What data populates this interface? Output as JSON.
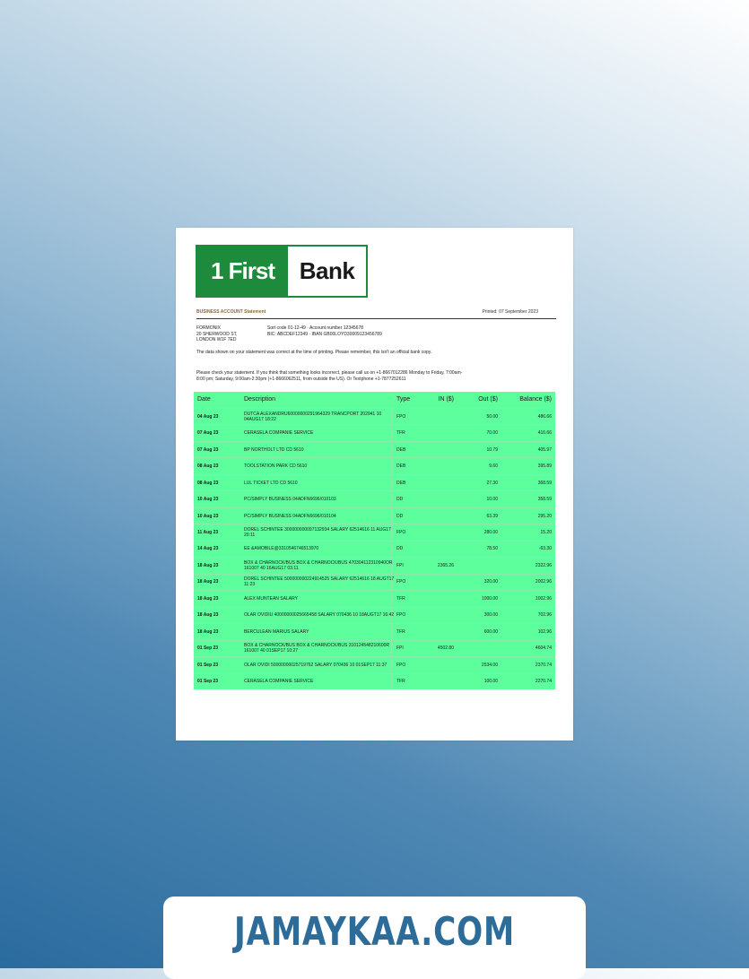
{
  "statement": {
    "logo": {
      "left": "1 First",
      "right": "Bank"
    },
    "header": {
      "title": "BUSINESS ACCOUNT Statement",
      "printed": "Printed: 07 September 2023"
    },
    "address": [
      "FORMONIX",
      "20 SHERWOOD ST,",
      "LONDON W1F 7ED"
    ],
    "codes": [
      "Sort code 01-12-49 · Account number 12345678",
      "BIC: ABCDEF12349 · IBAN GB00LOYD30009123456789"
    ],
    "note1": "The data shown on your statement was correct at the time of printing. Please remember, this isn't an official bank copy.",
    "note2": "Please check your statement. If you think that something looks incorrect, please call us on +1-8667012286 Monday to Friday, 7:00am-8:00 pm; Saturday, 9:00am-2:30pm (+1-8666062511, from outside the US). Or Textphone +1-7877252611",
    "columns": {
      "date": "Date",
      "desc": "Description",
      "type": "Type",
      "in": "IN ($)",
      "out": "Out ($)",
      "balance": "Balance ($)"
    },
    "rows": [
      {
        "date": "04 Aug 23",
        "desc": "DUTCA ALEXANDRU6000000029196432​9 TRANCPORT 202941 10 04AUG17 18:22",
        "type": "FPO",
        "in": "",
        "out": "50.00",
        "bal": "486.66"
      },
      {
        "date": "07 Aug 23",
        "desc": "CERASELA COMPANIE SERVICE",
        "type": "TFR",
        "in": "",
        "out": "70.00",
        "bal": "416.66"
      },
      {
        "date": "07 Aug 23",
        "desc": "BP NORTHOLT LTD CD 5610",
        "type": "DEB",
        "in": "",
        "out": "10.79",
        "bal": "405.97"
      },
      {
        "date": "08 Aug 23",
        "desc": "TOOLSTATION PARK CD 5610",
        "type": "DEB",
        "in": "",
        "out": "9.60",
        "bal": "395.89"
      },
      {
        "date": "08 Aug 23",
        "desc": "LUL TICKET LTD CD 5610",
        "type": "DEB",
        "in": "",
        "out": "27.30",
        "bal": "368.59"
      },
      {
        "date": "10 Aug 23",
        "desc": "PC/SIMPLY BUSINESS 04ADFN6696/010103",
        "type": "DD",
        "in": "",
        "out": "10.00",
        "bal": "358.59"
      },
      {
        "date": "10 Aug 23",
        "desc": "PC/SIMPLY BUSINESS 04ADFN6696/010104",
        "type": "DD",
        "in": "",
        "out": "63.39",
        "bal": "295.20"
      },
      {
        "date": "11 Aug 23",
        "desc": "DOREL SCHINTEE 300000000097132934 SALARY 62514616 11 AUG17 20:11",
        "type": "FPO",
        "in": "",
        "out": "280.00",
        "bal": "15.20"
      },
      {
        "date": "14 Aug 23",
        "desc": "EE &AMOBILE@3310546746513970",
        "type": "DD",
        "in": "",
        "out": "78.50",
        "bal": "-63.30"
      },
      {
        "date": "18 Aug 23",
        "desc": "BOX & CHARNOCK/BUS BOX & CHARNOCK/BUS 470304112310940OR 161007 40 16AUG17 03:11",
        "type": "FPI",
        "in": "2365.26",
        "out": "",
        "bal": "2322.96"
      },
      {
        "date": "18 Aug 23",
        "desc": "DOREL SCHINTEE 500000000224914525 SALARY 62514616 18 AUGT17 11:23",
        "type": "FPO",
        "in": "",
        "out": "320.00",
        "bal": "2002.96"
      },
      {
        "date": "18 Aug 23",
        "desc": "ALEX MUNTEAN SALARY",
        "type": "TFR",
        "in": "",
        "out": "1000.00",
        "bal": "1002.96"
      },
      {
        "date": "18 Aug 23",
        "desc": "OLAR OVIDIU 40000000025665458 SALARY 070436 10 18AUGT17 16:42",
        "type": "FPO",
        "in": "",
        "out": "300.00",
        "bal": "702.96"
      },
      {
        "date": "18 Aug 23",
        "desc": "BERCULEAN MARIUS SALARY",
        "type": "TFR",
        "in": "",
        "out": "600.00",
        "bal": "102.96"
      },
      {
        "date": "01 Sep 23",
        "desc": "BOX & CHARNOCK/BUS BOX & CHARNOCK/BUS 310124548210600R 161007 40 01SEP17 10:27",
        "type": "FPI",
        "in": "4502.80",
        "out": "",
        "bal": "4604.74"
      },
      {
        "date": "01 Sep 23",
        "desc": "OLAR OVIDI 50000000025719762 SALARY 070436 10 01SEP17 11:37",
        "type": "FPO",
        "in": "",
        "out": "2534.00",
        "bal": "2370.74"
      },
      {
        "date": "01 Sep 23",
        "desc": "CERASELA COMPANIE SERVICE",
        "type": "TFR",
        "in": "",
        "out": "100.00",
        "bal": "2270.74"
      }
    ]
  },
  "banner": {
    "text": "JAMAYKAA.COM"
  },
  "colors": {
    "bank_green": "#1e8a3c",
    "table_fill": "#5cff9c",
    "banner_text": "#2d6c98"
  }
}
